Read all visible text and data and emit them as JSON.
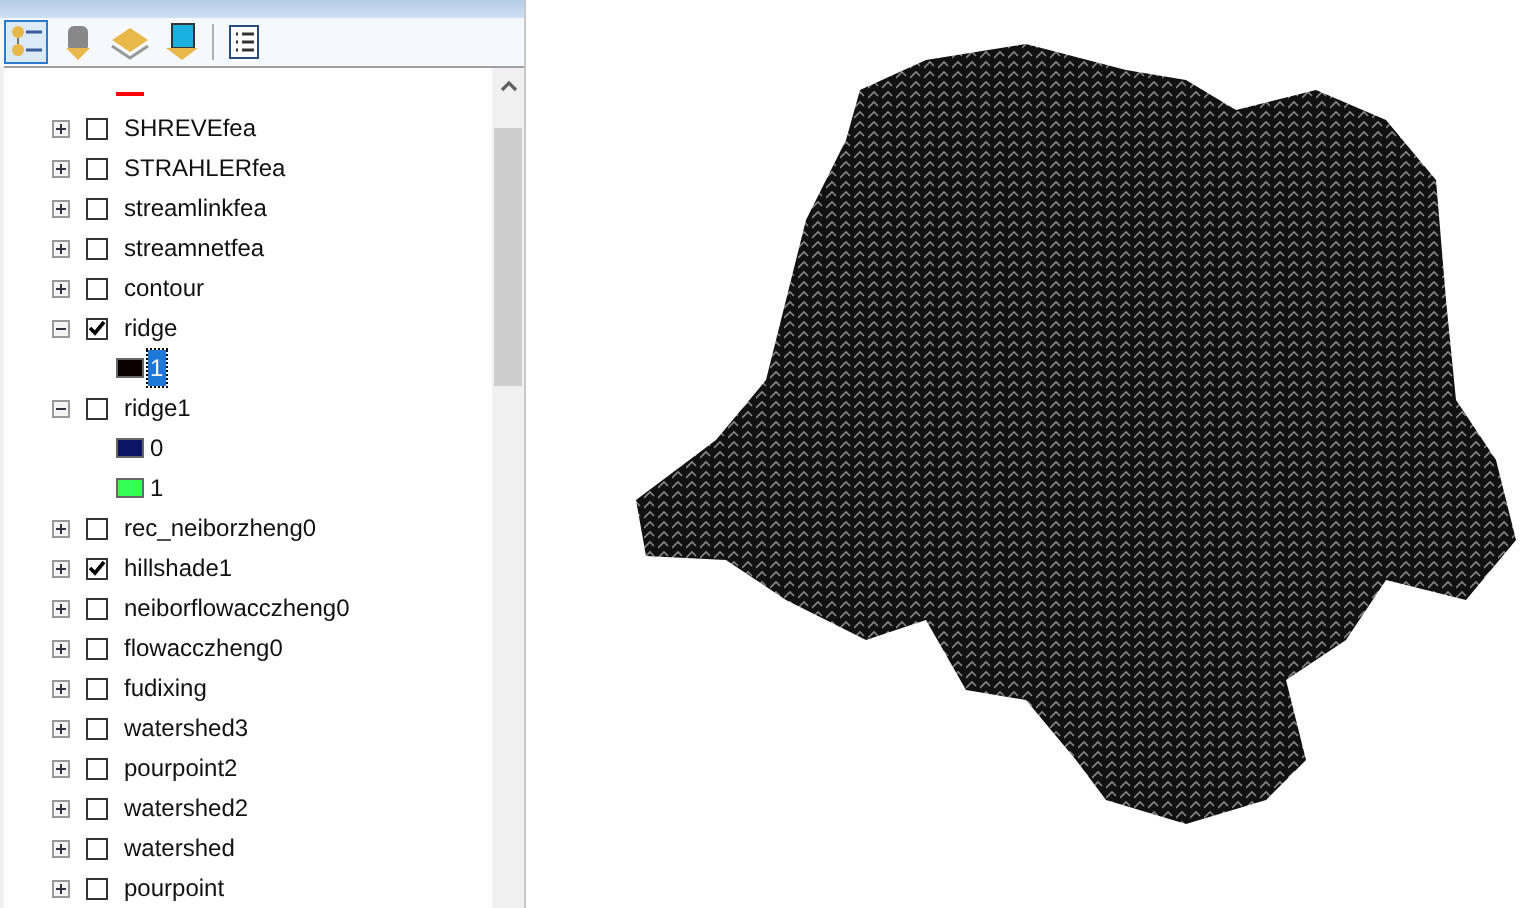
{
  "toolbar": {
    "buttons": [
      {
        "kind": "drawing-order",
        "selected": true
      },
      {
        "kind": "source",
        "selected": false
      },
      {
        "kind": "visibility",
        "selected": false
      },
      {
        "kind": "selection",
        "selected": false
      },
      {
        "kind": "options",
        "selected": false
      }
    ]
  },
  "legend_tail": {
    "color": "#ff0000"
  },
  "layers": [
    {
      "name": "SHREVEfea",
      "expanded": false,
      "checked": false
    },
    {
      "name": "STRAHLERfea",
      "expanded": false,
      "checked": false
    },
    {
      "name": "streamlinkfea",
      "expanded": false,
      "checked": false
    },
    {
      "name": "streamnetfea",
      "expanded": false,
      "checked": false
    },
    {
      "name": "contour",
      "expanded": false,
      "checked": false
    },
    {
      "name": "ridge",
      "expanded": true,
      "checked": true,
      "children": [
        {
          "label": "1",
          "color": "#0a0000",
          "selected": true
        }
      ]
    },
    {
      "name": "ridge1",
      "expanded": true,
      "checked": false,
      "children": [
        {
          "label": "0",
          "color": "#0c1466",
          "selected": false
        },
        {
          "label": "1",
          "color": "#33ff55",
          "selected": false
        }
      ]
    },
    {
      "name": "rec_neiborzheng0",
      "expanded": false,
      "checked": false
    },
    {
      "name": "hillshade1",
      "expanded": false,
      "checked": true
    },
    {
      "name": "neiborflowacczheng0",
      "expanded": false,
      "checked": false
    },
    {
      "name": "flowacczheng0",
      "expanded": false,
      "checked": false
    },
    {
      "name": "fudixing",
      "expanded": false,
      "checked": false
    },
    {
      "name": "watershed3",
      "expanded": false,
      "checked": false
    },
    {
      "name": "pourpoint2",
      "expanded": false,
      "checked": false
    },
    {
      "name": "watershed2",
      "expanded": false,
      "checked": false
    },
    {
      "name": "watershed",
      "expanded": false,
      "checked": false
    },
    {
      "name": "pourpoint",
      "expanded": false,
      "checked": false
    }
  ]
}
